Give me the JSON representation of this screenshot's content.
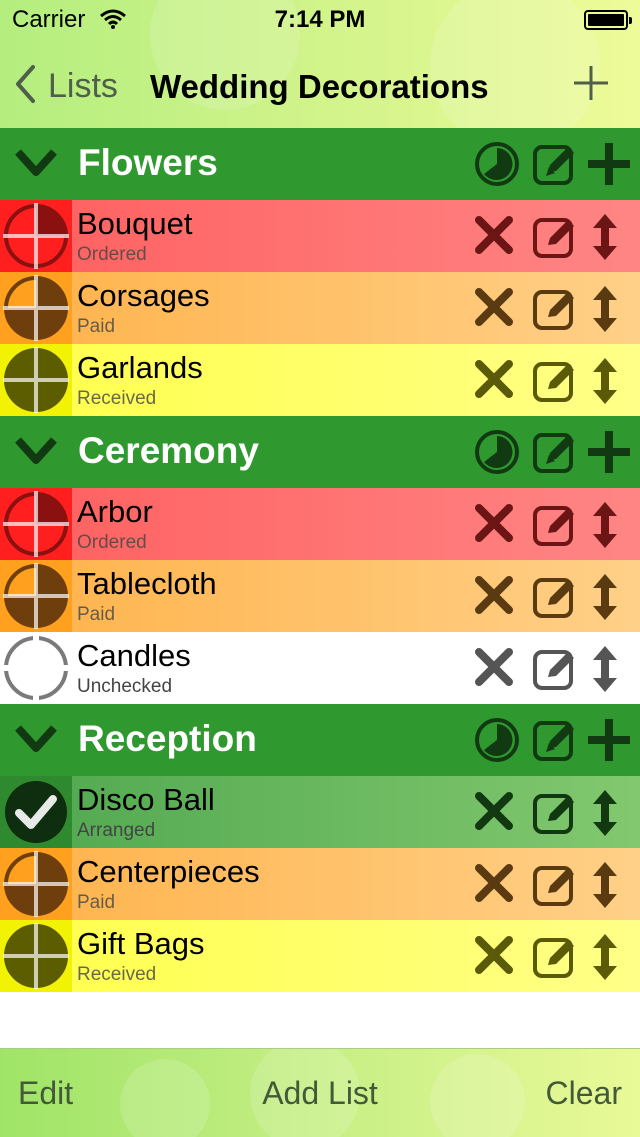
{
  "status_bar": {
    "carrier": "Carrier",
    "time": "7:14 PM"
  },
  "nav": {
    "back_label": "Lists",
    "title": "Wedding Decorations"
  },
  "sections": [
    {
      "title": "Flowers",
      "items": [
        {
          "name": "Bouquet",
          "status": "Ordered"
        },
        {
          "name": "Corsages",
          "status": "Paid"
        },
        {
          "name": "Garlands",
          "status": "Received"
        }
      ]
    },
    {
      "title": "Ceremony",
      "items": [
        {
          "name": "Arbor",
          "status": "Ordered"
        },
        {
          "name": "Tablecloth",
          "status": "Paid"
        },
        {
          "name": "Candles",
          "status": "Unchecked"
        }
      ]
    },
    {
      "title": "Reception",
      "items": [
        {
          "name": "Disco Ball",
          "status": "Arranged"
        },
        {
          "name": "Centerpieces",
          "status": "Paid"
        },
        {
          "name": "Gift Bags",
          "status": "Received"
        }
      ]
    }
  ],
  "toolbar": {
    "edit_label": "Edit",
    "add_list_label": "Add List",
    "clear_label": "Clear"
  },
  "colors": {
    "section_green": "#2f982f",
    "ordered": "#ff5f5f",
    "paid": "#ffb24a",
    "received": "#ffff4a",
    "unchecked": "#ffffff",
    "arranged": "#4fa74f"
  }
}
